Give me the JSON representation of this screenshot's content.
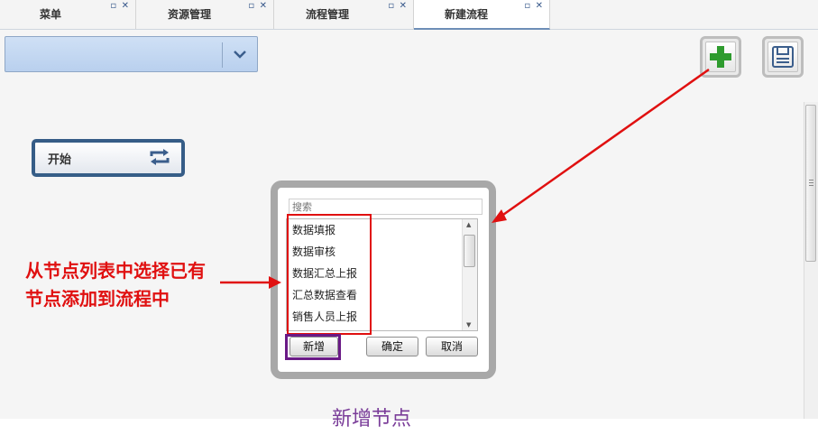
{
  "tabs": [
    {
      "label": "菜单",
      "active": false
    },
    {
      "label": "资源管理",
      "active": false
    },
    {
      "label": "流程管理",
      "active": false
    },
    {
      "label": "新建流程",
      "active": true
    }
  ],
  "toolbar": {
    "add_icon": "plus-icon",
    "save_icon": "save-icon"
  },
  "start_node": {
    "label": "开始",
    "icon": "loop-icon"
  },
  "popup": {
    "search_placeholder": "搜索",
    "items": [
      {
        "label": "数据填报"
      },
      {
        "label": "数据审核"
      },
      {
        "label": "数据汇总上报"
      },
      {
        "label": "汇总数据查看"
      },
      {
        "label": "销售人员上报"
      }
    ],
    "buttons": {
      "add": "新增",
      "ok": "确定",
      "cancel": "取消"
    }
  },
  "annotations": {
    "red_text": "从节点列表中选择已有节点添加到流程中",
    "purple_text": "新增节点"
  },
  "colors": {
    "annotation_red": "#e01010",
    "annotation_purple": "#7a3d99",
    "node_border": "#365d87",
    "plus_green": "#2e9b2e"
  }
}
